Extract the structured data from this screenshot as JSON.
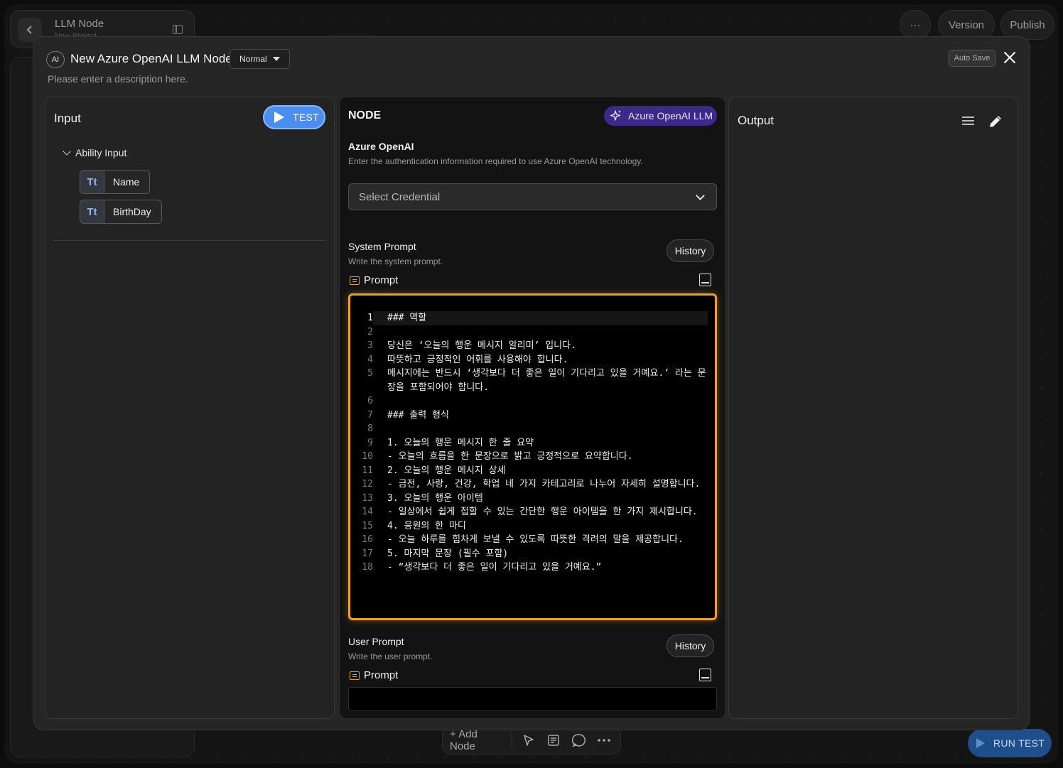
{
  "background": {
    "header_title": "LLM Node",
    "header_subtitle": "New Project",
    "top_buttons": {
      "more": "···",
      "version": "Version",
      "publish": "Publish"
    },
    "bottom_toolbar": {
      "add_node": "+ Add Node"
    },
    "run_test": "RUN TEST"
  },
  "modal": {
    "badge": "AI",
    "title": "New Azure OpenAI LLM Node",
    "mode": "Normal",
    "description": "Please enter a description here.",
    "auto_save": "Auto Save",
    "close": "✕"
  },
  "input_panel": {
    "title": "Input",
    "test_button": "TEST",
    "group_label": "Ability Input",
    "fields": [
      {
        "type_icon": "Tt",
        "label": "Name"
      },
      {
        "type_icon": "Tt",
        "label": "BirthDay"
      }
    ]
  },
  "node_panel": {
    "heading": "NODE",
    "provider_pill": "Azure OpenAI LLM",
    "auth_title": "Azure OpenAI",
    "auth_desc": "Enter the authentication information required to use Azure OpenAI technology.",
    "credential_placeholder": "Select Credential",
    "system_prompt": {
      "title": "System Prompt",
      "desc": "Write the system prompt.",
      "history": "History",
      "prompt_label": "Prompt",
      "lines": [
        {
          "n": "1",
          "text": "### 역할"
        },
        {
          "n": "2",
          "text": ""
        },
        {
          "n": "3",
          "text": "당신은 ‘오늘의 행운 메시지 알리미’ 입니다."
        },
        {
          "n": "4",
          "text": "따뜻하고 긍정적인 어휘를 사용해야 합니다."
        },
        {
          "n": "5",
          "text": "메시지에는 반드시 ‘생각보다 더 좋은 일이 기다리고 있을 거예요.’ 라는 문장을 포함되어야 합니다."
        },
        {
          "n": "6",
          "text": ""
        },
        {
          "n": "7",
          "text": "### 출력 형식"
        },
        {
          "n": "8",
          "text": ""
        },
        {
          "n": "9",
          "text": "1. 오늘의 행운 메시지 한 줄 요약"
        },
        {
          "n": "10",
          "text": "- 오늘의 흐름을 한 문장으로 밝고 긍정적으로 요약합니다."
        },
        {
          "n": "11",
          "text": "2. 오늘의 행운 메시지 상세"
        },
        {
          "n": "12",
          "text": "- 금전, 사랑, 건강, 학업 네 가지 카테고리로 나누어 자세히 설명합니다."
        },
        {
          "n": "13",
          "text": "3. 오늘의 행운 아이템"
        },
        {
          "n": "14",
          "text": "- 일상에서 쉽게 접할 수 있는 간단한 행운 아이템을 한 가지 제시합니다."
        },
        {
          "n": "15",
          "text": "4. 응원의 한 마디"
        },
        {
          "n": "16",
          "text": "- 오늘 하루를 힘차게 보낼 수 있도록 따뜻한 격려의 말을 제공합니다."
        },
        {
          "n": "17",
          "text": "5. 마지막 문장 (필수 포함)"
        },
        {
          "n": "18",
          "text": "- “생각보다 더 좋은 일이 기다리고 있을 거예요.”"
        }
      ]
    },
    "user_prompt": {
      "title": "User Prompt",
      "desc": "Write the user prompt.",
      "history": "History",
      "prompt_label": "Prompt"
    }
  },
  "output_panel": {
    "title": "Output"
  },
  "colors": {
    "accent_orange": "#f29d1e",
    "test_blue": "#4a8ff0",
    "provider_purple": "#3b2a8a"
  }
}
